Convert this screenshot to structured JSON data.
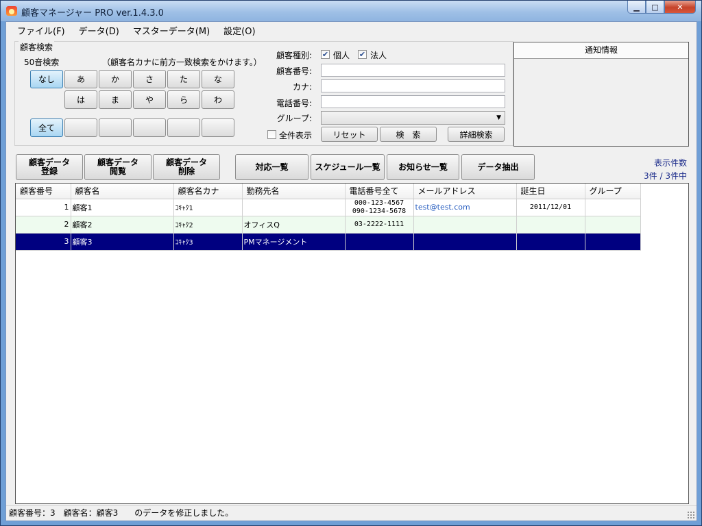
{
  "window": {
    "title": "顧客マネージャー PRO ver.1.4.3.0",
    "controls": {
      "minimize": "▁",
      "maximize": "□",
      "close": "✕"
    }
  },
  "menu": [
    "ファイル(F)",
    "データ(D)",
    "マスターデータ(M)",
    "設定(O)"
  ],
  "search": {
    "legend": "顧客検索",
    "kana_label": "50音検索",
    "kana_note": "（顧客名カナに前方一致検索をかけます。）",
    "kana_row1": [
      "なし",
      "あ",
      "か",
      "さ",
      "た",
      "な"
    ],
    "kana_row2": [
      "は",
      "ま",
      "や",
      "ら",
      "わ"
    ],
    "kana_row3": [
      "全て",
      "",
      "",
      "",
      "",
      ""
    ],
    "type_label": "顧客種別:",
    "type_individual": "個人",
    "type_corporate": "法人",
    "type_individual_checked": true,
    "type_corporate_checked": true,
    "number_label": "顧客番号:",
    "kana_field_label": "カナ:",
    "phone_label": "電話番号:",
    "group_label": "グループ:",
    "number_value": "",
    "kana_value": "",
    "phone_value": "",
    "group_value": "",
    "show_all_label": "全件表示",
    "show_all_checked": false,
    "reset_button": "リセット",
    "search_button": "検　索",
    "detail_search_button": "詳細検索"
  },
  "notice": {
    "header": "通知情報"
  },
  "actions": {
    "register": "顧客データ登録",
    "browse": "顧客データ閲覧",
    "delete": "顧客データ削除",
    "response_list": "対応一覧",
    "schedule_list": "スケジュール一覧",
    "notice_list": "お知らせ一覧",
    "extract": "データ抽出"
  },
  "count": {
    "label": "表示件数",
    "value": "3件 / 3件中"
  },
  "grid": {
    "columns": [
      "顧客番号",
      "顧客名",
      "顧客名カナ",
      "勤務先名",
      "電話番号全て",
      "メールアドレス",
      "誕生日",
      "グループ"
    ],
    "rows": [
      {
        "id": "1",
        "name": "顧客1",
        "kana": "ｺｷｬｸ1",
        "company": "",
        "phone1": "000-123-4567",
        "phone2": "090-1234-5678",
        "email": "test@test.com",
        "birthday": "2011/12/01",
        "group": ""
      },
      {
        "id": "2",
        "name": "顧客2",
        "kana": "ｺｷｬｸ2",
        "company": "オフィスQ",
        "phone1": "03-2222-1111",
        "phone2": "",
        "email": "",
        "birthday": "",
        "group": ""
      },
      {
        "id": "3",
        "name": "顧客3",
        "kana": "ｺｷｬｸ3",
        "company": "PMマネージメント",
        "phone1": "",
        "phone2": "",
        "email": "",
        "birthday": "",
        "group": ""
      }
    ]
  },
  "status": {
    "message": "顧客番号：3　顧客名：顧客3　　のデータを修正しました。"
  }
}
